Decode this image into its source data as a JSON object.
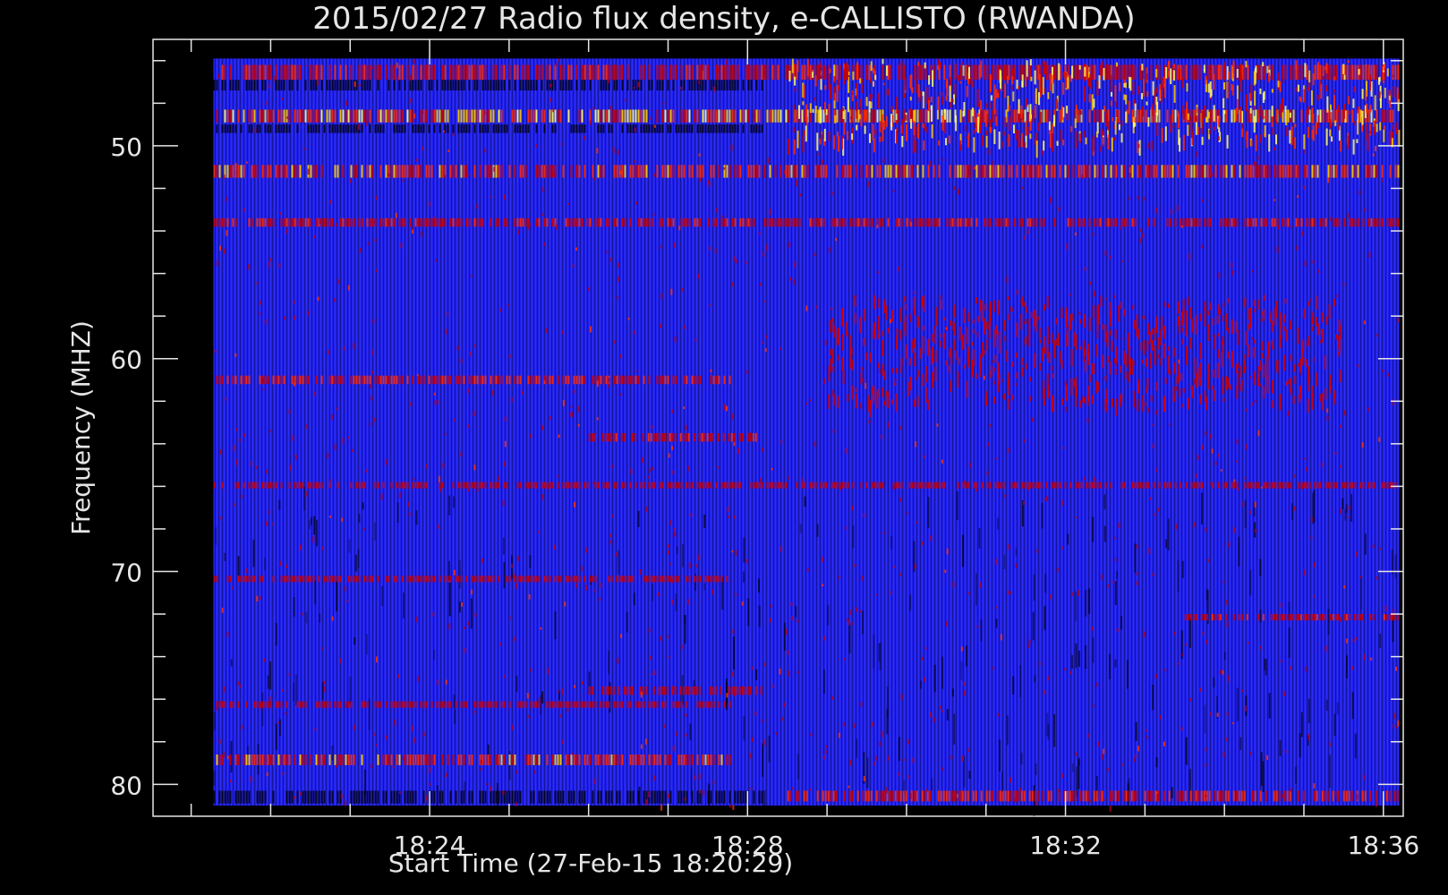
{
  "chart_data": {
    "type": "heatmap",
    "title": "2015/02/27  Radio flux density, e-CALLISTO (RWANDA)",
    "xlabel": "Start Time (27-Feb-15 18:20:29)",
    "ylabel": "Frequency (MHZ)",
    "x_ticks": [
      "18:24",
      "18:28",
      "18:32",
      "18:36"
    ],
    "x_tick_minutes": [
      24,
      28,
      32,
      36
    ],
    "y_ticks": [
      50,
      60,
      70,
      80
    ],
    "xlim_minutes": [
      20.52,
      36.25
    ],
    "ylim": [
      45,
      81.5
    ],
    "y_inverted": true,
    "data_x_range_minutes": [
      21.28,
      36.2
    ],
    "data_y_range": [
      45.9,
      81
    ],
    "grid": false,
    "legend": "none",
    "colormap": [
      "#000000",
      "#0000cc",
      "#3030ff",
      "#cc0000",
      "#ff2a00",
      "#ffcc00",
      "#ffff66"
    ],
    "colors": {
      "background": "#000000",
      "axes": "#e6e6e6",
      "noise_base": "#2020ee"
    },
    "bands": [
      {
        "f_lo": 46.2,
        "f_hi": 46.9,
        "t_start": 21.28,
        "t_end": 36.2,
        "intensity": 0.6
      },
      {
        "f_lo": 48.3,
        "f_hi": 48.9,
        "t_start": 21.28,
        "t_end": 36.2,
        "intensity": 0.9
      },
      {
        "f_lo": 50.9,
        "f_hi": 51.5,
        "t_start": 21.28,
        "t_end": 36.2,
        "intensity": 0.8
      },
      {
        "f_lo": 53.4,
        "f_hi": 53.8,
        "t_start": 21.28,
        "t_end": 36.2,
        "intensity": 0.6
      },
      {
        "f_lo": 60.8,
        "f_hi": 61.2,
        "t_start": 21.28,
        "t_end": 27.8,
        "intensity": 0.7
      },
      {
        "f_lo": 63.5,
        "f_hi": 63.9,
        "t_start": 26.0,
        "t_end": 28.2,
        "intensity": 0.6
      },
      {
        "f_lo": 65.8,
        "f_hi": 66.1,
        "t_start": 21.28,
        "t_end": 36.2,
        "intensity": 0.5
      },
      {
        "f_lo": 70.2,
        "f_hi": 70.5,
        "t_start": 21.28,
        "t_end": 27.8,
        "intensity": 0.5
      },
      {
        "f_lo": 72.0,
        "f_hi": 72.3,
        "t_start": 33.5,
        "t_end": 36.2,
        "intensity": 0.6
      },
      {
        "f_lo": 75.4,
        "f_hi": 75.8,
        "t_start": 26.0,
        "t_end": 28.2,
        "intensity": 0.5
      },
      {
        "f_lo": 76.1,
        "f_hi": 76.4,
        "t_start": 21.28,
        "t_end": 27.8,
        "intensity": 0.45
      },
      {
        "f_lo": 78.6,
        "f_hi": 79.1,
        "t_start": 21.28,
        "t_end": 27.8,
        "intensity": 0.8
      },
      {
        "f_lo": 80.3,
        "f_hi": 80.8,
        "t_start": 28.5,
        "t_end": 36.2,
        "intensity": 0.7
      }
    ],
    "dark_bands": [
      {
        "f_lo": 46.9,
        "f_hi": 47.4,
        "t_start": 21.28,
        "t_end": 28.2
      },
      {
        "f_lo": 49.0,
        "f_hi": 49.4,
        "t_start": 21.28,
        "t_end": 28.2
      },
      {
        "f_lo": 80.3,
        "f_hi": 80.9,
        "t_start": 21.28,
        "t_end": 28.2
      }
    ],
    "bursts": [
      {
        "f_lo": 45.9,
        "f_hi": 49.8,
        "t_start": 28.5,
        "t_end": 36.2,
        "intensity": 1.0
      },
      {
        "f_lo": 57.0,
        "f_hi": 62.0,
        "t_start": 29.0,
        "t_end": 35.5,
        "intensity": 0.3
      }
    ]
  }
}
